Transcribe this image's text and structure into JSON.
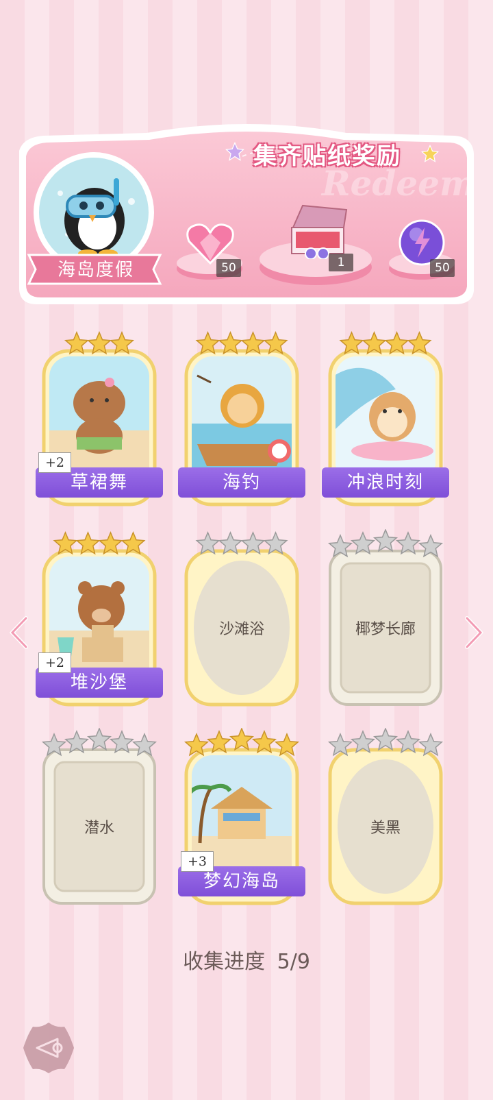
{
  "banner": {
    "title": "集齐贴纸奖励",
    "watermark": "Redeem",
    "theme_name": "海岛度假",
    "rewards": [
      {
        "icon": "pink-heart-gem-icon",
        "count": "50"
      },
      {
        "icon": "gift-box-icon",
        "count": "1"
      },
      {
        "icon": "energy-orb-icon",
        "count": "50"
      }
    ]
  },
  "cards": [
    {
      "name": "草裙舞",
      "unlocked": true,
      "stars_lit": 3,
      "stars_total": 3,
      "plus": "+2",
      "art": "capybara-hula"
    },
    {
      "name": "海钓",
      "unlocked": true,
      "stars_lit": 4,
      "stars_total": 4,
      "plus": "",
      "art": "lion-fishing"
    },
    {
      "name": "冲浪时刻",
      "unlocked": true,
      "stars_lit": 4,
      "stars_total": 4,
      "plus": "",
      "art": "hamster-surf"
    },
    {
      "name": "堆沙堡",
      "unlocked": true,
      "stars_lit": 4,
      "stars_total": 4,
      "plus": "+2",
      "art": "bear-sandcastle"
    },
    {
      "name": "沙滩浴",
      "unlocked": false,
      "stars_lit": 0,
      "stars_total": 4,
      "plus": "",
      "art": "oval"
    },
    {
      "name": "椰梦长廊",
      "unlocked": false,
      "stars_lit": 0,
      "stars_total": 5,
      "plus": "",
      "art": "rect"
    },
    {
      "name": "潜水",
      "unlocked": false,
      "stars_lit": 0,
      "stars_total": 5,
      "plus": "",
      "art": "rect"
    },
    {
      "name": "梦幻海岛",
      "unlocked": true,
      "stars_lit": 5,
      "stars_total": 5,
      "plus": "+3",
      "art": "beach-hut"
    },
    {
      "name": "美黑",
      "unlocked": false,
      "stars_lit": 0,
      "stars_total": 5,
      "plus": "",
      "art": "oval"
    }
  ],
  "progress": {
    "label": "收集进度",
    "value": "5/9"
  },
  "colors": {
    "accent_purple": "#8a5ae0",
    "banner_pink": "#f7a9c0",
    "gold": "#f2c94c",
    "locked_bg": "#e7e0d2"
  }
}
